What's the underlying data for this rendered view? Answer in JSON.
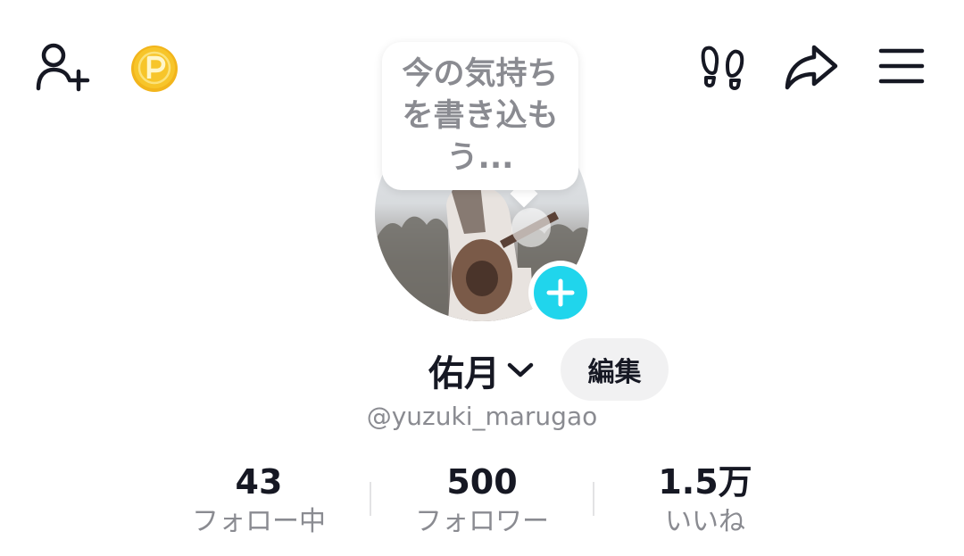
{
  "header": {
    "left_icons": [
      "add-friend-icon",
      "coin-icon"
    ],
    "right_icons": [
      "footprints-icon",
      "share-icon",
      "menu-icon"
    ]
  },
  "status_bubble": {
    "text": "今の気持ちを書き込もう..."
  },
  "profile": {
    "display_name": "佑月",
    "edit_label": "編集",
    "username": "@yuzuki_marugao"
  },
  "stats": [
    {
      "value": "43",
      "label": "フォロー中"
    },
    {
      "value": "500",
      "label": "フォロワー"
    },
    {
      "value": "1.5万",
      "label": "いいね"
    }
  ],
  "colors": {
    "accent": "#20d5ec",
    "coin": "#f7c52a",
    "text_primary": "#161823",
    "text_secondary": "#8a8b91",
    "button_bg": "#f1f1f2"
  }
}
